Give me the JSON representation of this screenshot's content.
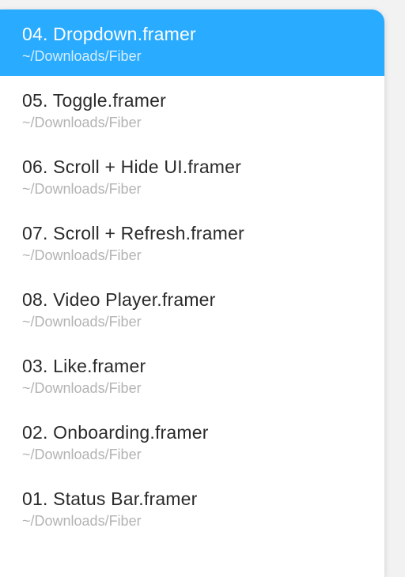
{
  "items": [
    {
      "title": "04. Dropdown.framer",
      "subtitle": "~/Downloads/Fiber",
      "selected": true
    },
    {
      "title": "05. Toggle.framer",
      "subtitle": "~/Downloads/Fiber",
      "selected": false
    },
    {
      "title": "06. Scroll + Hide UI.framer",
      "subtitle": "~/Downloads/Fiber",
      "selected": false
    },
    {
      "title": "07. Scroll + Refresh.framer",
      "subtitle": "~/Downloads/Fiber",
      "selected": false
    },
    {
      "title": "08. Video Player.framer",
      "subtitle": "~/Downloads/Fiber",
      "selected": false
    },
    {
      "title": "03. Like.framer",
      "subtitle": "~/Downloads/Fiber",
      "selected": false
    },
    {
      "title": "02. Onboarding.framer",
      "subtitle": "~/Downloads/Fiber",
      "selected": false
    },
    {
      "title": "01. Status Bar.framer",
      "subtitle": "~/Downloads/Fiber",
      "selected": false
    }
  ],
  "colors": {
    "accent": "#29abff",
    "subtitle": "#b3b3b3"
  }
}
